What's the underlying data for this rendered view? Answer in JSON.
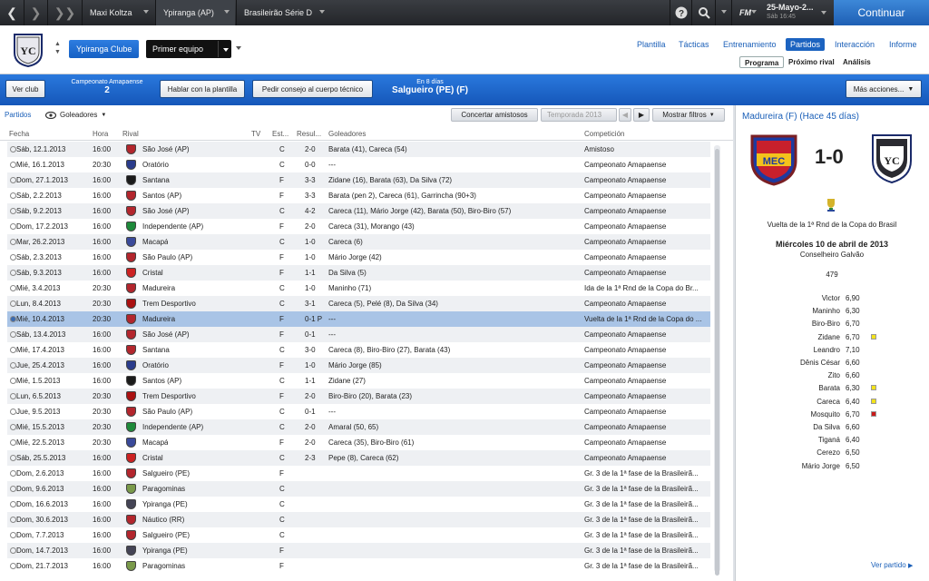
{
  "topbar": {
    "tab1": "Maxi Koltza",
    "tab2": "Ypiranga (AP)",
    "tab3": "Brasileirão Série D",
    "date": "25-Mayo-2...",
    "time": "Sáb 16:45",
    "continue": "Continuar",
    "fm": "FM"
  },
  "header": {
    "club": "Ypiranga Clube",
    "team": "Primer equipo",
    "nav": [
      "Plantilla",
      "Tácticas",
      "Entrenamiento",
      "Partidos",
      "Interacción",
      "Informe"
    ],
    "subnav": [
      "Programa",
      "Próximo rival",
      "Análisis"
    ]
  },
  "actionbar": {
    "club_btn": "Ver club",
    "comp_name": "Campeonato Amapaense",
    "comp_pos": "2",
    "talk": "Hablar con la plantilla",
    "advice": "Pedir consejo al cuerpo técnico",
    "next_label": "En 8 días",
    "next_match": "Salgueiro (PE) (F)",
    "more": "Más acciones..."
  },
  "toolbar": {
    "partidos": "Partidos",
    "goleadores": "Goleadores",
    "friendlies": "Concertar amistosos",
    "season": "Temporada 2013",
    "filters": "Mostrar filtros"
  },
  "columns": [
    "Fecha",
    "Hora",
    "Rival",
    "TV",
    "Est...",
    "Resul...",
    "Goleadores",
    "Competición"
  ],
  "rows": [
    [
      "Sáb, 12.1.2013",
      "16:00",
      "São José (AP)",
      "C",
      "2-0",
      "Barata (41), Careca (54)",
      "Amistoso"
    ],
    [
      "Mié, 16.1.2013",
      "20:30",
      "Oratório",
      "C",
      "0-0",
      "---",
      "Campeonato Amapaense"
    ],
    [
      "Dom, 27.1.2013",
      "16:00",
      "Santana",
      "F",
      "3-3",
      "Zidane (16), Barata (63), Da Silva (72)",
      "Campeonato Amapaense"
    ],
    [
      "Sáb, 2.2.2013",
      "16:00",
      "Santos (AP)",
      "F",
      "3-3",
      "Barata (pen 2), Careca (61), Garrincha (90+3)",
      "Campeonato Amapaense"
    ],
    [
      "Sáb, 9.2.2013",
      "16:00",
      "São José (AP)",
      "C",
      "4-2",
      "Careca (11), Mário Jorge (42), Barata (50), Biro-Biro (57)",
      "Campeonato Amapaense"
    ],
    [
      "Dom, 17.2.2013",
      "16:00",
      "Independente (AP)",
      "F",
      "2-0",
      "Careca (31), Morango (43)",
      "Campeonato Amapaense"
    ],
    [
      "Mar, 26.2.2013",
      "16:00",
      "Macapá",
      "C",
      "1-0",
      "Careca (6)",
      "Campeonato Amapaense"
    ],
    [
      "Sáb, 2.3.2013",
      "16:00",
      "São Paulo (AP)",
      "F",
      "1-0",
      "Mário Jorge (42)",
      "Campeonato Amapaense"
    ],
    [
      "Sáb, 9.3.2013",
      "16:00",
      "Cristal",
      "F",
      "1-1",
      "Da Silva (5)",
      "Campeonato Amapaense"
    ],
    [
      "Mié, 3.4.2013",
      "20:30",
      "Madureira",
      "C",
      "1-0",
      "Maninho (71)",
      "Ida de la 1ª Rnd de la Copa do Br..."
    ],
    [
      "Lun, 8.4.2013",
      "20:30",
      "Trem Desportivo",
      "C",
      "3-1",
      "Careca (5), Pelé (8), Da Silva (34)",
      "Campeonato Amapaense"
    ],
    [
      "Mié, 10.4.2013",
      "20:30",
      "Madureira",
      "F",
      "0-1 P",
      "---",
      "Vuelta de la 1ª Rnd de la Copa do ..."
    ],
    [
      "Sáb, 13.4.2013",
      "16:00",
      "São José (AP)",
      "F",
      "0-1",
      "---",
      "Campeonato Amapaense"
    ],
    [
      "Mié, 17.4.2013",
      "16:00",
      "Santana",
      "C",
      "3-0",
      "Careca (8), Biro-Biro (27), Barata (43)",
      "Campeonato Amapaense"
    ],
    [
      "Jue, 25.4.2013",
      "16:00",
      "Oratório",
      "F",
      "1-0",
      "Mário Jorge (85)",
      "Campeonato Amapaense"
    ],
    [
      "Mié, 1.5.2013",
      "16:00",
      "Santos (AP)",
      "C",
      "1-1",
      "Zidane (27)",
      "Campeonato Amapaense"
    ],
    [
      "Lun, 6.5.2013",
      "20:30",
      "Trem Desportivo",
      "F",
      "2-0",
      "Biro-Biro (20), Barata (23)",
      "Campeonato Amapaense"
    ],
    [
      "Jue, 9.5.2013",
      "20:30",
      "São Paulo (AP)",
      "C",
      "0-1",
      "---",
      "Campeonato Amapaense"
    ],
    [
      "Mié, 15.5.2013",
      "20:30",
      "Independente (AP)",
      "C",
      "2-0",
      "Amaral (50, 65)",
      "Campeonato Amapaense"
    ],
    [
      "Mié, 22.5.2013",
      "20:30",
      "Macapá",
      "F",
      "2-0",
      "Careca (35), Biro-Biro (61)",
      "Campeonato Amapaense"
    ],
    [
      "Sáb, 25.5.2013",
      "16:00",
      "Cristal",
      "C",
      "2-3",
      "Pepe (8), Careca (62)",
      "Campeonato Amapaense"
    ],
    [
      "Dom, 2.6.2013",
      "16:00",
      "Salgueiro (PE)",
      "F",
      "",
      "",
      "Gr. 3 de la 1ª fase de la Brasileirã..."
    ],
    [
      "Dom, 9.6.2013",
      "16:00",
      "Paragominas",
      "C",
      "",
      "",
      "Gr. 3 de la 1ª fase de la Brasileirã..."
    ],
    [
      "Dom, 16.6.2013",
      "16:00",
      "Ypiranga (PE)",
      "C",
      "",
      "",
      "Gr. 3 de la 1ª fase de la Brasileirã..."
    ],
    [
      "Dom, 30.6.2013",
      "16:00",
      "Náutico (RR)",
      "C",
      "",
      "",
      "Gr. 3 de la 1ª fase de la Brasileirã..."
    ],
    [
      "Dom, 7.7.2013",
      "16:00",
      "Salgueiro (PE)",
      "C",
      "",
      "",
      "Gr. 3 de la 1ª fase de la Brasileirã..."
    ],
    [
      "Dom, 14.7.2013",
      "16:00",
      "Ypiranga (PE)",
      "F",
      "",
      "",
      "Gr. 3 de la 1ª fase de la Brasileirã..."
    ],
    [
      "Dom, 21.7.2013",
      "16:00",
      "Paragominas",
      "F",
      "",
      "",
      "Gr. 3 de la 1ª fase de la Brasileirã..."
    ]
  ],
  "crest_colors": [
    "#b3262d",
    "#2a3c8c",
    "#1b1b1b",
    "#b3262d",
    "#b3262d",
    "#1e8a3a",
    "#3a4a9a",
    "#b3262d",
    "#c22",
    "#b3262d",
    "#a11",
    "#b3262d",
    "#b3262d",
    "#b3262d",
    "#2a3c8c",
    "#1b1b1b",
    "#a11",
    "#b3262d",
    "#1e8a3a",
    "#3a4a9a",
    "#c22",
    "#b3262d",
    "#7a9a4a",
    "#445",
    "#b3262d",
    "#b3262d",
    "#445",
    "#7a9a4a"
  ],
  "side": {
    "title": "Madureira (F) (Hace 45 días)",
    "score": "1-0",
    "round": "Vuelta de la 1ª Rnd de la Copa do Brasil",
    "date": "Miércoles 10 de abril de 2013",
    "stadium": "Conselheiro Galvão",
    "attendance": "479",
    "link": "Ver partido",
    "players": [
      [
        "Victor",
        "6,90",
        ""
      ],
      [
        "Maninho",
        "6,30",
        ""
      ],
      [
        "Biro-Biro",
        "6,70",
        ""
      ],
      [
        "Zidane",
        "6,70",
        "yellow"
      ],
      [
        "Leandro",
        "7,10",
        ""
      ],
      [
        "Dênis César",
        "6,60",
        ""
      ],
      [
        "Zito",
        "6,60",
        ""
      ],
      [
        "Barata",
        "6,30",
        "yellow"
      ],
      [
        "Careca",
        "6,40",
        "yellow"
      ],
      [
        "Mosquito",
        "6,70",
        "red"
      ],
      [
        "Da Silva",
        "6,60",
        ""
      ],
      [
        "Tiganá",
        "6,40",
        ""
      ],
      [
        "Cerezo",
        "6,50",
        ""
      ],
      [
        "Mário Jorge",
        "6,50",
        ""
      ]
    ]
  }
}
